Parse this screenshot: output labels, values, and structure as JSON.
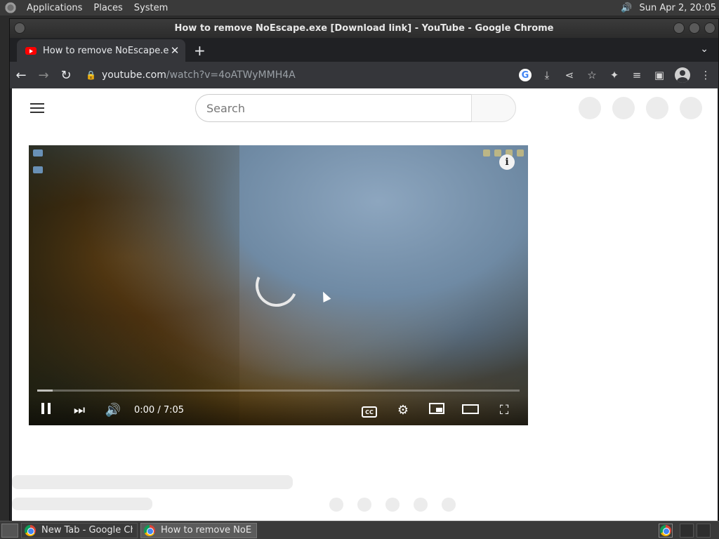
{
  "top_panel": {
    "menus": [
      "Applications",
      "Places",
      "System"
    ],
    "clock": "Sun Apr  2, 20:05"
  },
  "window": {
    "title": "How to remove NoEscape.exe [Download link] - YouTube - Google Chrome"
  },
  "browser": {
    "tab_title": "How to remove NoEscape.exe [Download link] - YouTube",
    "tab_close": "✕",
    "new_tab": "+",
    "tab_search": "⌄",
    "url_host": "youtube.com",
    "url_path": "/watch?v=4oATWyMMH4A"
  },
  "youtube": {
    "search_placeholder": "Search",
    "player": {
      "time": "0:00 / 7:05",
      "info": "i",
      "cc": "CC",
      "progress_fraction": 0.0
    }
  },
  "taskbar": {
    "tasks": [
      {
        "label": "New Tab - Google Chrome",
        "active": false
      },
      {
        "label": "How to remove NoEscape.exe [Download link] - YouTube - Google Chrome",
        "active": true
      }
    ]
  },
  "colors": {
    "youtube_red": "#ff0000",
    "chrome_toolbar": "#35363a",
    "panel": "#3a3a3a"
  }
}
